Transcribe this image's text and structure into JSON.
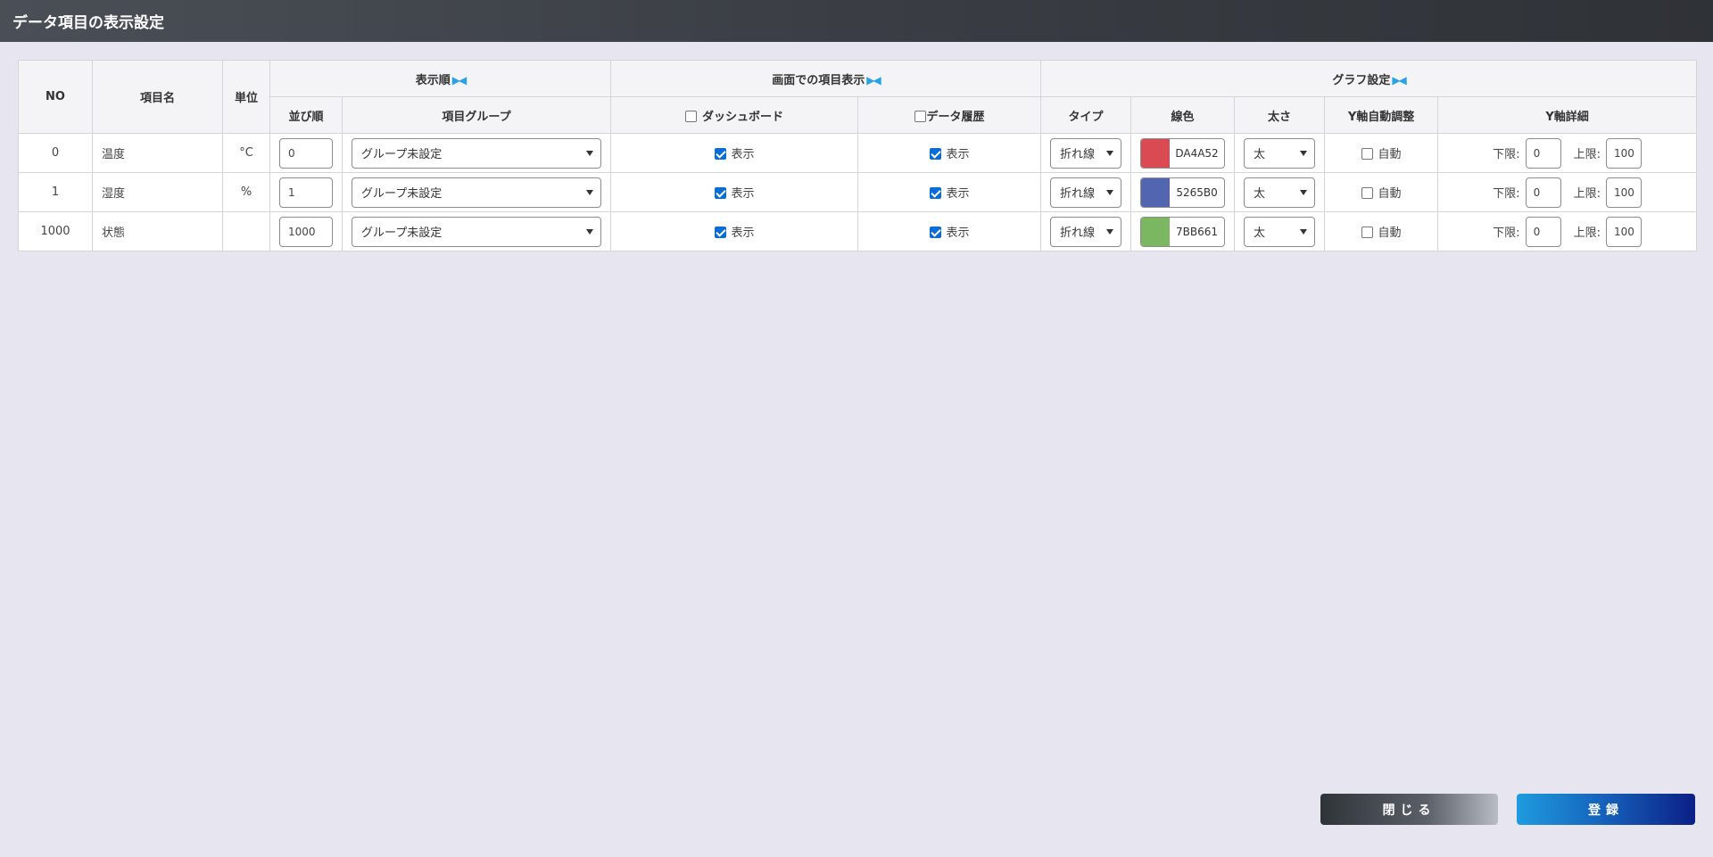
{
  "window": {
    "title": "データ項目の表示設定"
  },
  "header": {
    "no": "NO",
    "name": "項目名",
    "unit": "単位",
    "display_order_group": "表示順",
    "screen_display_group": "画面での項目表示",
    "graph_settings_group": "グラフ設定",
    "toggle_glyph": "▶◀",
    "order": "並び順",
    "item_group": "項目グループ",
    "dashboard": "ダッシュボード",
    "data_history": "データ履歴",
    "type": "タイプ",
    "line_color": "線色",
    "thickness": "太さ",
    "y_auto": "Y軸自動調整",
    "y_detail": "Y軸詳細"
  },
  "labels": {
    "show": "表示",
    "auto": "自動",
    "lower": "下限:",
    "upper": "上限:"
  },
  "rows": [
    {
      "no": "0",
      "name": "温度",
      "unit": "°C",
      "order": "0",
      "group": "グループ未設定",
      "dashboard": true,
      "history": true,
      "type": "折れ線",
      "color": "#DA4A52",
      "color_hex": "DA4A52",
      "thickness": "太",
      "y_auto": false,
      "lower": "0",
      "upper": "100"
    },
    {
      "no": "1",
      "name": "湿度",
      "unit": "%",
      "order": "1",
      "group": "グループ未設定",
      "dashboard": true,
      "history": true,
      "type": "折れ線",
      "color": "#5265B0",
      "color_hex": "5265B0",
      "thickness": "太",
      "y_auto": false,
      "lower": "0",
      "upper": "100"
    },
    {
      "no": "1000",
      "name": "状態",
      "unit": "",
      "order": "1000",
      "group": "グループ未設定",
      "dashboard": true,
      "history": true,
      "type": "折れ線",
      "color": "#7BB661",
      "color_hex": "7BB661",
      "thickness": "太",
      "y_auto": false,
      "lower": "0",
      "upper": "100"
    }
  ],
  "footer": {
    "close": "閉じる",
    "register": "登録"
  },
  "colors": {
    "accent": "#2AA3E6",
    "checkbox": "#0A6CD6"
  }
}
